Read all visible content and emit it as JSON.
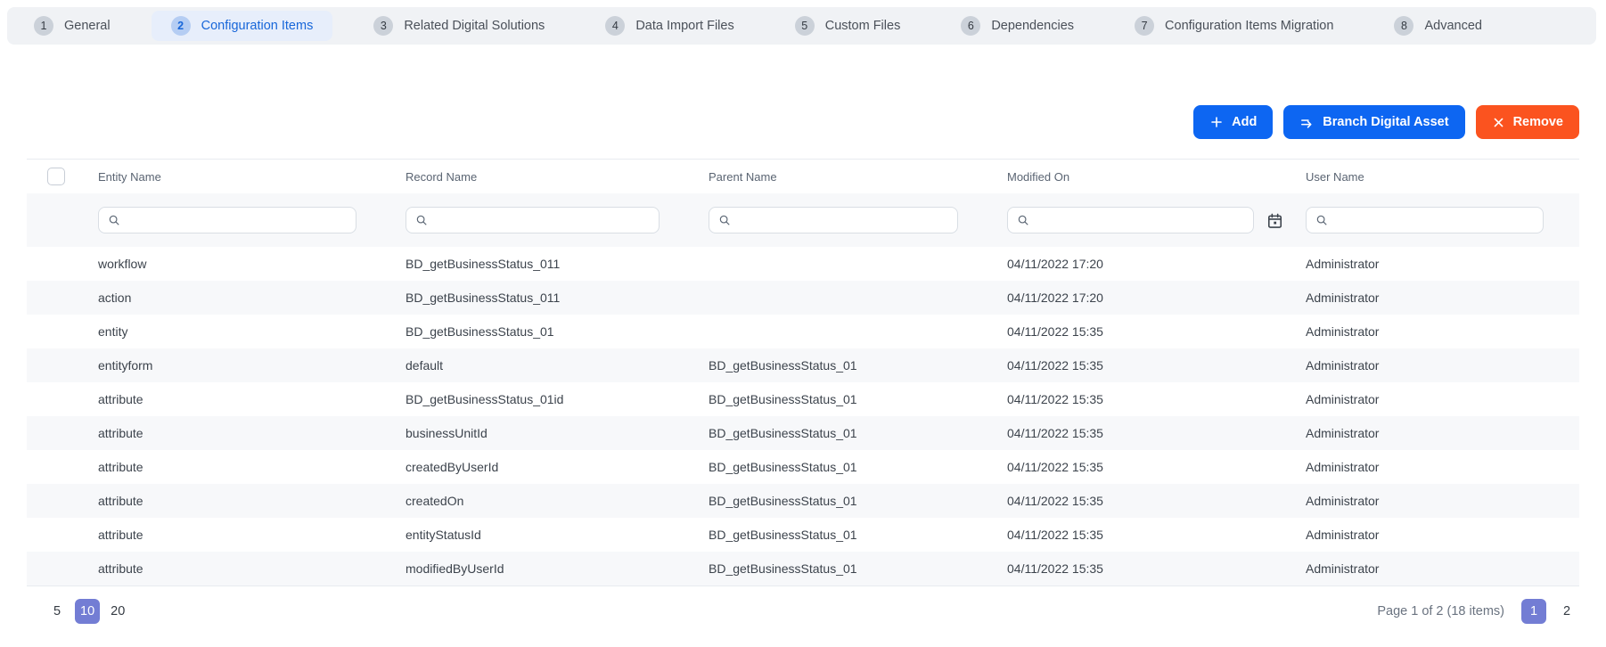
{
  "tab_bar": {
    "tabs": [
      {
        "num": "1",
        "label": "General",
        "active": false
      },
      {
        "num": "2",
        "label": "Configuration Items",
        "active": true
      },
      {
        "num": "3",
        "label": "Related Digital Solutions",
        "active": false
      },
      {
        "num": "4",
        "label": "Data Import Files",
        "active": false
      },
      {
        "num": "5",
        "label": "Custom Files",
        "active": false
      },
      {
        "num": "6",
        "label": "Dependencies",
        "active": false
      },
      {
        "num": "7",
        "label": "Configuration Items Migration",
        "active": false
      },
      {
        "num": "8",
        "label": "Advanced",
        "active": false
      }
    ]
  },
  "toolbar": {
    "add_label": "Add",
    "branch_label": "Branch Digital Asset",
    "remove_label": "Remove"
  },
  "table": {
    "columns": [
      "Entity Name",
      "Record Name",
      "Parent Name",
      "Modified On",
      "User Name"
    ],
    "filters": {
      "entity_value": "",
      "record_value": "",
      "parent_value": "",
      "modified_value": "",
      "user_value": "",
      "placeholder": ""
    },
    "rows": [
      {
        "entity": "workflow",
        "record": "BD_getBusinessStatus_011",
        "parent": "",
        "modified": "04/11/2022 17:20",
        "user": "Administrator"
      },
      {
        "entity": "action",
        "record": "BD_getBusinessStatus_011",
        "parent": "",
        "modified": "04/11/2022 17:20",
        "user": "Administrator"
      },
      {
        "entity": "entity",
        "record": "BD_getBusinessStatus_01",
        "parent": "",
        "modified": "04/11/2022 15:35",
        "user": "Administrator"
      },
      {
        "entity": "entityform",
        "record": "default",
        "parent": "BD_getBusinessStatus_01",
        "modified": "04/11/2022 15:35",
        "user": "Administrator"
      },
      {
        "entity": "attribute",
        "record": "BD_getBusinessStatus_01id",
        "parent": "BD_getBusinessStatus_01",
        "modified": "04/11/2022 15:35",
        "user": "Administrator"
      },
      {
        "entity": "attribute",
        "record": "businessUnitId",
        "parent": "BD_getBusinessStatus_01",
        "modified": "04/11/2022 15:35",
        "user": "Administrator"
      },
      {
        "entity": "attribute",
        "record": "createdByUserId",
        "parent": "BD_getBusinessStatus_01",
        "modified": "04/11/2022 15:35",
        "user": "Administrator"
      },
      {
        "entity": "attribute",
        "record": "createdOn",
        "parent": "BD_getBusinessStatus_01",
        "modified": "04/11/2022 15:35",
        "user": "Administrator"
      },
      {
        "entity": "attribute",
        "record": "entityStatusId",
        "parent": "BD_getBusinessStatus_01",
        "modified": "04/11/2022 15:35",
        "user": "Administrator"
      },
      {
        "entity": "attribute",
        "record": "modifiedByUserId",
        "parent": "BD_getBusinessStatus_01",
        "modified": "04/11/2022 15:35",
        "user": "Administrator"
      }
    ]
  },
  "pagination": {
    "page_sizes": [
      "5",
      "10",
      "20"
    ],
    "active_size": "10",
    "info": "Page 1 of 2 (18 items)",
    "pages": [
      "1",
      "2"
    ],
    "active_page": "1"
  },
  "icons": {
    "add": "plus-icon",
    "branch": "branch-icon",
    "remove": "x-icon",
    "filter": "search-icon",
    "date": "calendar-icon"
  },
  "colors": {
    "accent_blue": "#0d66f2",
    "remove_orange": "#fb531f",
    "active_tab_blue": "#1766d9",
    "active_tab_bg": "#e7eefb",
    "tab_bar_bg": "#f0f2f5",
    "pagination_active": "#737dd4",
    "row_alt_bg": "#f7f8fa"
  }
}
